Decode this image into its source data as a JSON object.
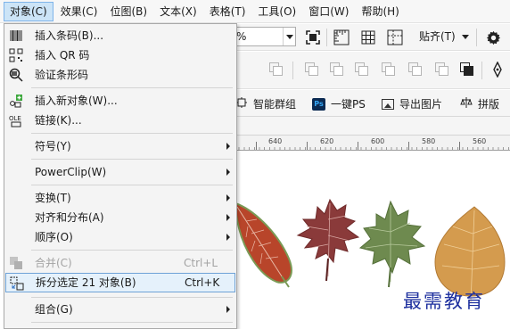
{
  "menubar": {
    "items": [
      "对象(C)",
      "效果(C)",
      "位图(B)",
      "文本(X)",
      "表格(T)",
      "工具(O)",
      "窗口(W)",
      "帮助(H)"
    ]
  },
  "toolbar": {
    "zoom_value": "%",
    "snap_label": "贴齐(T)",
    "smart_group": "智能群组",
    "ps_icon_text": "Ps",
    "one_key_ps": "一键PS",
    "export_image": "导出图片",
    "tile_layout": "拼版"
  },
  "ruler": {
    "labels": [
      "640",
      "620",
      "600",
      "580",
      "560"
    ]
  },
  "menu": {
    "items": [
      {
        "label": "插入条码(B)...",
        "icon": "barcode-icon"
      },
      {
        "label": "插入 QR 码",
        "icon": "qr-code-icon"
      },
      {
        "label": "验证条形码",
        "icon": "verify-barcode-icon"
      },
      {
        "label": "插入新对象(W)...",
        "icon": "insert-object-icon"
      },
      {
        "label": "链接(K)...",
        "icon": "ole-link-icon"
      },
      {
        "label": "符号(Y)",
        "submenu": true
      },
      {
        "label": "PowerClip(W)",
        "submenu": true
      },
      {
        "label": "变换(T)",
        "submenu": true
      },
      {
        "label": "对齐和分布(A)",
        "submenu": true
      },
      {
        "label": "顺序(O)",
        "submenu": true
      },
      {
        "label": "合并(C)",
        "shortcut": "Ctrl+L",
        "disabled": true,
        "icon": "combine-icon"
      },
      {
        "label": "拆分选定 21 对象(B)",
        "shortcut": "Ctrl+K",
        "highlighted": true,
        "icon": "break-apart-icon"
      },
      {
        "label": "组合(G)",
        "submenu": true
      }
    ]
  },
  "watermark": "最需教育",
  "colors": {
    "menu_highlight": "#e5f1fb",
    "menu_highlight_border": "#6ea2d6",
    "menubar_active": "#cce4f7",
    "watermark": "#1d2f9e"
  }
}
